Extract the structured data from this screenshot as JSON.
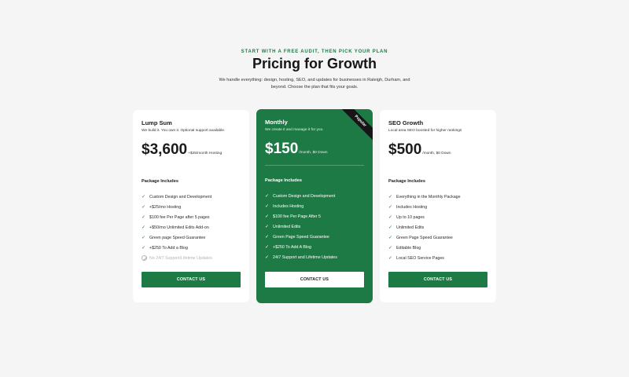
{
  "header": {
    "eyebrow": "START WITH A FREE AUDIT, THEN PICK YOUR PLAN",
    "title": "Pricing for Growth",
    "subtitle": "We handle everything: design, hosting, SEO, and updates for businesses in Raleigh, Durham, and beyond. Choose the plan that fits your goals."
  },
  "colors": {
    "accent": "#1d7a44",
    "background": "#f5f5f5",
    "ribbon": "#161616"
  },
  "plans": [
    {
      "name": "Lump Sum",
      "description": "We build it. You own it. Optional support available.",
      "price": "$3,600",
      "price_suffix": "+$25/month Hosting",
      "features_title": "Package Includes",
      "features": [
        "Custom Design and Development",
        "+$25/mo Hosting",
        "$100 fee Per Page after 5 pages",
        "+$50/mo Unlimited Edits Add-on",
        "Green page Speed Guarantee",
        "+$250 To Add a Blog"
      ],
      "excluded_feature": "No 24/7 Support/Lifetime Updates",
      "cta": "CONTACT US"
    },
    {
      "name": "Monthly",
      "description": "We create it and manage it for you.",
      "price": "$150",
      "price_suffix": "/month, $0 Down",
      "badge": "Popular",
      "features_title": "Package Includes",
      "features": [
        "Custom Design and Development",
        "Includes Hosting",
        "$100 fee Per Page After 5",
        "Unlimited Edits",
        "Green Page Speed Guarantee",
        "+$250 To Add A Blog",
        "24/7 Support and Lifetime Updates"
      ],
      "cta": "CONTACT US"
    },
    {
      "name": "SEO Growth",
      "description": "Local area SEO boosted for higher rankings",
      "price": "$500",
      "price_suffix": "/month, $0 Down",
      "features_title": "Package Includes",
      "features": [
        "Everything in the Monthly Package",
        "Includes Hosting",
        "Up to 10 pages",
        "Unlimited Edits",
        "Green Page Speed Guarantee",
        "Editable Blog",
        "Local SEO Service Pages"
      ],
      "cta": "CONTACT US"
    }
  ],
  "icons": {
    "check": "check-icon",
    "excluded": "prohibited-icon"
  }
}
